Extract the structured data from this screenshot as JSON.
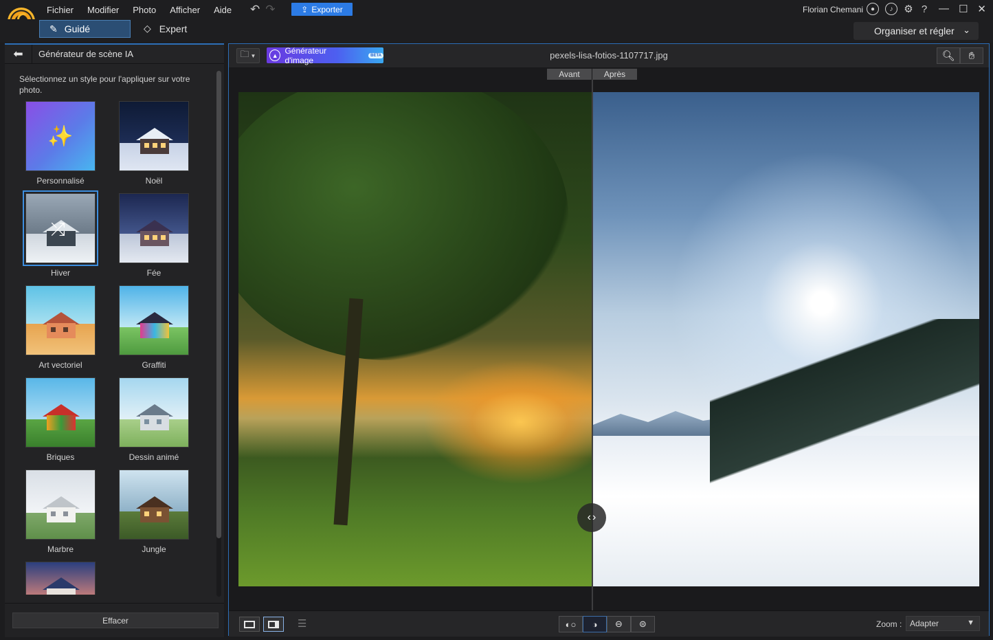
{
  "app": {
    "menu": [
      "Fichier",
      "Modifier",
      "Photo",
      "Afficher",
      "Aide"
    ],
    "export_label": "Exporter",
    "user_name": "Florian Chemani",
    "help_glyph": "?"
  },
  "modes": {
    "guide_label": "Guidé",
    "expert_label": "Expert",
    "workspace_label": "Organiser et régler"
  },
  "left_panel": {
    "title": "Générateur de scène IA",
    "description": "Sélectionnez un style pour l'appliquer sur votre photo.",
    "styles": [
      {
        "label": "Personnalisé",
        "icon": "magic-wand-icon"
      },
      {
        "label": "Noël"
      },
      {
        "label": "Hiver",
        "selected": true,
        "icon": "shuffle-icon"
      },
      {
        "label": "Fée"
      },
      {
        "label": "Art vectoriel"
      },
      {
        "label": "Graffiti"
      },
      {
        "label": "Briques"
      },
      {
        "label": "Dessin animé"
      },
      {
        "label": "Marbre"
      },
      {
        "label": "Jungle"
      },
      {
        "label": ""
      }
    ],
    "clear_label": "Effacer"
  },
  "canvas": {
    "generator_label": "Générateur d'image",
    "beta_badge": "BETA",
    "filename": "pexels-lisa-fotios-1107717.jpg",
    "before_label": "Avant",
    "after_label": "Après",
    "zoom_label": "Zoom :",
    "zoom_value": "Adapter"
  },
  "colors": {
    "accent": "#2c7be5",
    "panel_border": "#2d6fb8",
    "guide_active": "#2b4e74"
  }
}
